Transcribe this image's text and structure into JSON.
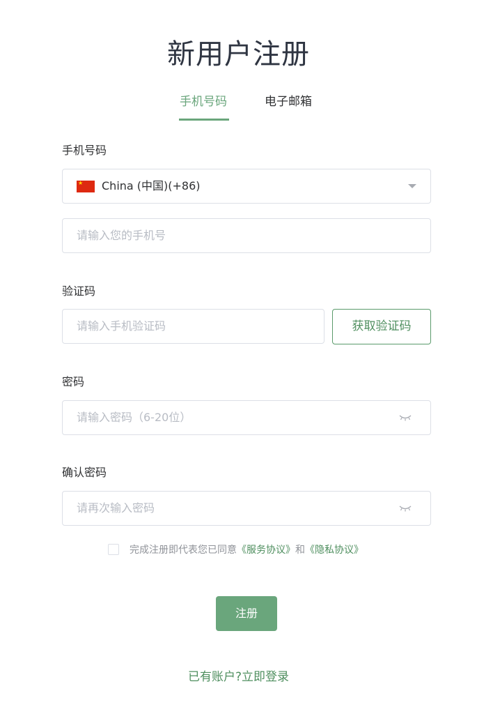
{
  "title": "新用户注册",
  "tabs": [
    {
      "label": "手机号码",
      "active": true
    },
    {
      "label": "电子邮箱",
      "active": false
    }
  ],
  "phone_section": {
    "label": "手机号码",
    "country": "China (中国)(+86)",
    "phone_placeholder": "请输入您的手机号"
  },
  "code_section": {
    "label": "验证码",
    "placeholder": "请输入手机验证码",
    "button_label": "获取验证码"
  },
  "password_section": {
    "label": "密码",
    "placeholder": "请输入密码（6-20位）"
  },
  "confirm_section": {
    "label": "确认密码",
    "placeholder": "请再次输入密码"
  },
  "agreement": {
    "prefix": "完成注册即代表您已同意",
    "service_link": "《服务协议》",
    "and": "和",
    "privacy_link": "《隐私协议》"
  },
  "submit_label": "注册",
  "login_link": "已有账户?立即登录",
  "colors": {
    "accent": "#6aa67c",
    "link": "#4f8f5f",
    "border": "#dcdfe6",
    "placeholder": "#b8bcc4"
  },
  "icons": {
    "country_flag": "china-flag-icon",
    "dropdown": "chevron-down-icon",
    "password_visibility": "eye-closed-icon"
  }
}
